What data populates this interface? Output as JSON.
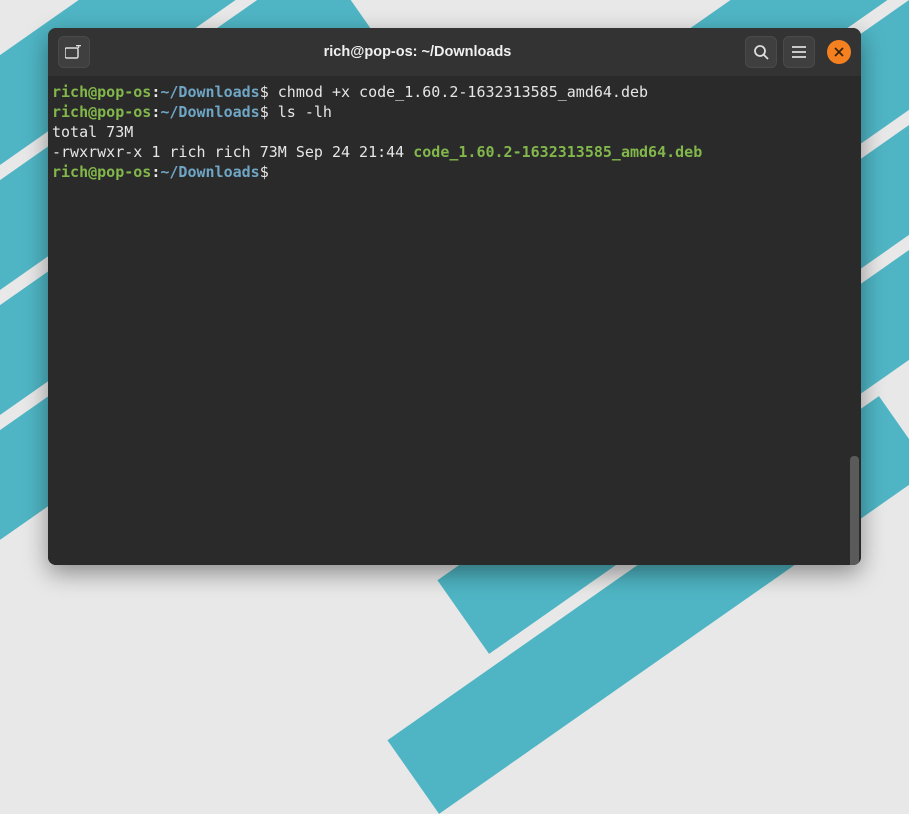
{
  "titlebar": {
    "title": "rich@pop-os: ~/Downloads"
  },
  "prompt": {
    "user_host": "rich@pop-os",
    "colon": ":",
    "path": "~/Downloads",
    "symbol": "$"
  },
  "lines": {
    "cmd1": " chmod +x code_1.60.2-1632313585_amd64.deb",
    "cmd2": " ls -lh",
    "out1": "total 73M",
    "out2a": "-rwxrwxr-x 1 rich rich 73M Sep 24 21:44 ",
    "out2b": "code_1.60.2-1632313585_amd64.deb",
    "cmd3": " "
  }
}
